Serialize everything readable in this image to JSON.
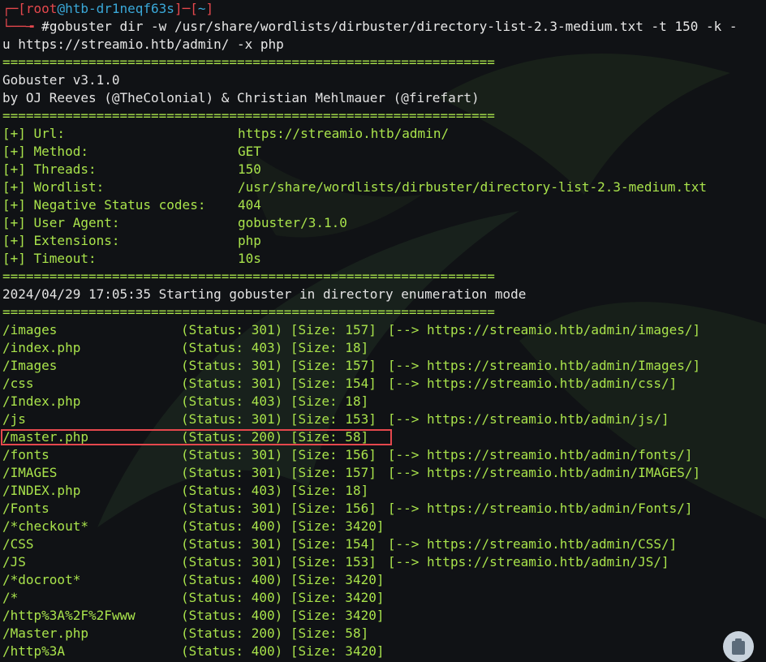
{
  "prompt": {
    "open": "┌─[",
    "user": "root",
    "at": "@",
    "host": "htb-dr1neqf63s",
    "mid": "]─[",
    "dir": "~",
    "close": "]",
    "pre": "└──╼ ",
    "hash": "#"
  },
  "command_line1": "gobuster dir -w /usr/share/wordlists/dirbuster/directory-list-2.3-medium.txt -t 150 -k -",
  "command_line2": "u https://streamio.htb/admin/ -x php",
  "separator": "===============================================================",
  "banner": {
    "version": "Gobuster v3.1.0",
    "authors": "by OJ Reeves (@TheColonial) & Christian Mehlmauer (@firefart)"
  },
  "config": [
    {
      "label": "[+] Url:",
      "value": "https://streamio.htb/admin/"
    },
    {
      "label": "[+] Method:",
      "value": "GET"
    },
    {
      "label": "[+] Threads:",
      "value": "150"
    },
    {
      "label": "[+] Wordlist:",
      "value": "/usr/share/wordlists/dirbuster/directory-list-2.3-medium.txt"
    },
    {
      "label": "[+] Negative Status codes:",
      "value": "404"
    },
    {
      "label": "[+] User Agent:",
      "value": "gobuster/3.1.0"
    },
    {
      "label": "[+] Extensions:",
      "value": "php"
    },
    {
      "label": "[+] Timeout:",
      "value": "10s"
    }
  ],
  "start_message": "2024/04/29 17:05:35 Starting gobuster in directory enumeration mode",
  "results": [
    {
      "path": "/images",
      "status": "(Status: 301)",
      "size": "[Size: 157]",
      "redirect": "[--> https://streamio.htb/admin/images/]"
    },
    {
      "path": "/index.php",
      "status": "(Status: 403)",
      "size": "[Size: 18]",
      "redirect": ""
    },
    {
      "path": "/Images",
      "status": "(Status: 301)",
      "size": "[Size: 157]",
      "redirect": "[--> https://streamio.htb/admin/Images/]"
    },
    {
      "path": "/css",
      "status": "(Status: 301)",
      "size": "[Size: 154]",
      "redirect": "[--> https://streamio.htb/admin/css/]"
    },
    {
      "path": "/Index.php",
      "status": "(Status: 403)",
      "size": "[Size: 18]",
      "redirect": ""
    },
    {
      "path": "/js",
      "status": "(Status: 301)",
      "size": "[Size: 153]",
      "redirect": "[--> https://streamio.htb/admin/js/]"
    },
    {
      "path": "/master.php",
      "status": "(Status: 200)",
      "size": "[Size: 58]",
      "redirect": ""
    },
    {
      "path": "/fonts",
      "status": "(Status: 301)",
      "size": "[Size: 156]",
      "redirect": "[--> https://streamio.htb/admin/fonts/]"
    },
    {
      "path": "/IMAGES",
      "status": "(Status: 301)",
      "size": "[Size: 157]",
      "redirect": "[--> https://streamio.htb/admin/IMAGES/]"
    },
    {
      "path": "/INDEX.php",
      "status": "(Status: 403)",
      "size": "[Size: 18]",
      "redirect": ""
    },
    {
      "path": "/Fonts",
      "status": "(Status: 301)",
      "size": "[Size: 156]",
      "redirect": "[--> https://streamio.htb/admin/Fonts/]"
    },
    {
      "path": "/*checkout*",
      "status": "(Status: 400)",
      "size": "[Size: 3420]",
      "redirect": ""
    },
    {
      "path": "/CSS",
      "status": "(Status: 301)",
      "size": "[Size: 154]",
      "redirect": "[--> https://streamio.htb/admin/CSS/]"
    },
    {
      "path": "/JS",
      "status": "(Status: 301)",
      "size": "[Size: 153]",
      "redirect": "[--> https://streamio.htb/admin/JS/]"
    },
    {
      "path": "/*docroot*",
      "status": "(Status: 400)",
      "size": "[Size: 3420]",
      "redirect": ""
    },
    {
      "path": "/*",
      "status": "(Status: 400)",
      "size": "[Size: 3420]",
      "redirect": ""
    },
    {
      "path": "/http%3A%2F%2Fwww",
      "status": "(Status: 400)",
      "size": "[Size: 3420]",
      "redirect": ""
    },
    {
      "path": "/Master.php",
      "status": "(Status: 200)",
      "size": "[Size: 58]",
      "redirect": ""
    },
    {
      "path": "/http%3A",
      "status": "(Status: 400)",
      "size": "[Size: 3420]",
      "redirect": ""
    }
  ],
  "highlight": {
    "row": "/master.php",
    "color": "#e5484d"
  },
  "colors": {
    "background": "#101215",
    "green": "#a9e34b",
    "red": "#e5484d",
    "blue": "#3aa8d8",
    "text": "#e3e3e3"
  },
  "icons": {
    "clipboard": "clipboard-icon"
  }
}
